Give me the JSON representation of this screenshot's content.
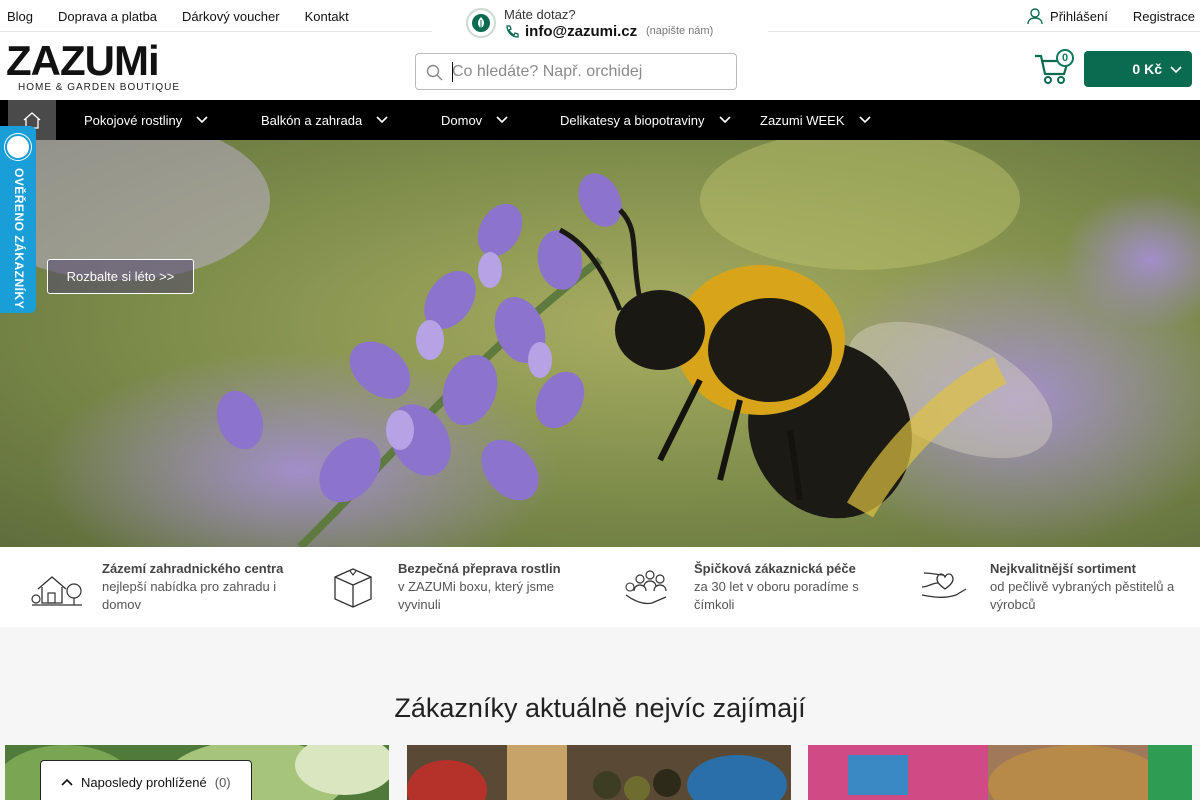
{
  "topbar": {
    "links": [
      "Blog",
      "Doprava a platba",
      "Dárkový voucher",
      "Kontakt"
    ],
    "contact_question": "Máte dotaz?",
    "contact_email": "info@zazumi.cz",
    "contact_note": "(napište nám)",
    "login": "Přihlášení",
    "register": "Registrace"
  },
  "header": {
    "logo_word": "ZAZUMi",
    "logo_sub": "HOME & GARDEN BOUTIQUE",
    "search_placeholder": "Co hledáte? Např. orchidej",
    "cart_count": "0",
    "cart_total": "0 Kč"
  },
  "nav": {
    "items": [
      "Pokojové rostliny",
      "Balkón a zahrada",
      "Domov",
      "Delikatesy a biopotraviny",
      "Zazumi WEEK"
    ]
  },
  "verified_badge": "OVĚŘENO ZÁKAZNÍKY",
  "hero": {
    "button": "Rozbalte si léto >>"
  },
  "benefits": [
    {
      "title": "Zázemí zahradnického centra",
      "desc": "nejlepší nabídka pro zahradu i domov",
      "icon": "garden-house-icon"
    },
    {
      "title": "Bezpečná přeprava rostlin",
      "desc": "v ZAZUMi boxu, který jsme vyvinuli",
      "icon": "box-icon"
    },
    {
      "title": "Špičková zákaznická péče",
      "desc": "za 30 let v oboru poradíme s čímkoli",
      "icon": "customer-care-icon"
    },
    {
      "title": "Nejkvalitnější sortiment",
      "desc": "od pečlivě vybraných pěstitelů a výrobců",
      "icon": "heart-hands-icon"
    }
  ],
  "section": {
    "title": "Zákazníky aktuálně nejvíc zajímají"
  },
  "recent": {
    "label": "Naposledy prohlížené",
    "count": "(0)"
  },
  "colors": {
    "brand_green": "#0b6b51",
    "badge_blue": "#1a9ed8",
    "nav_black": "#000000"
  }
}
